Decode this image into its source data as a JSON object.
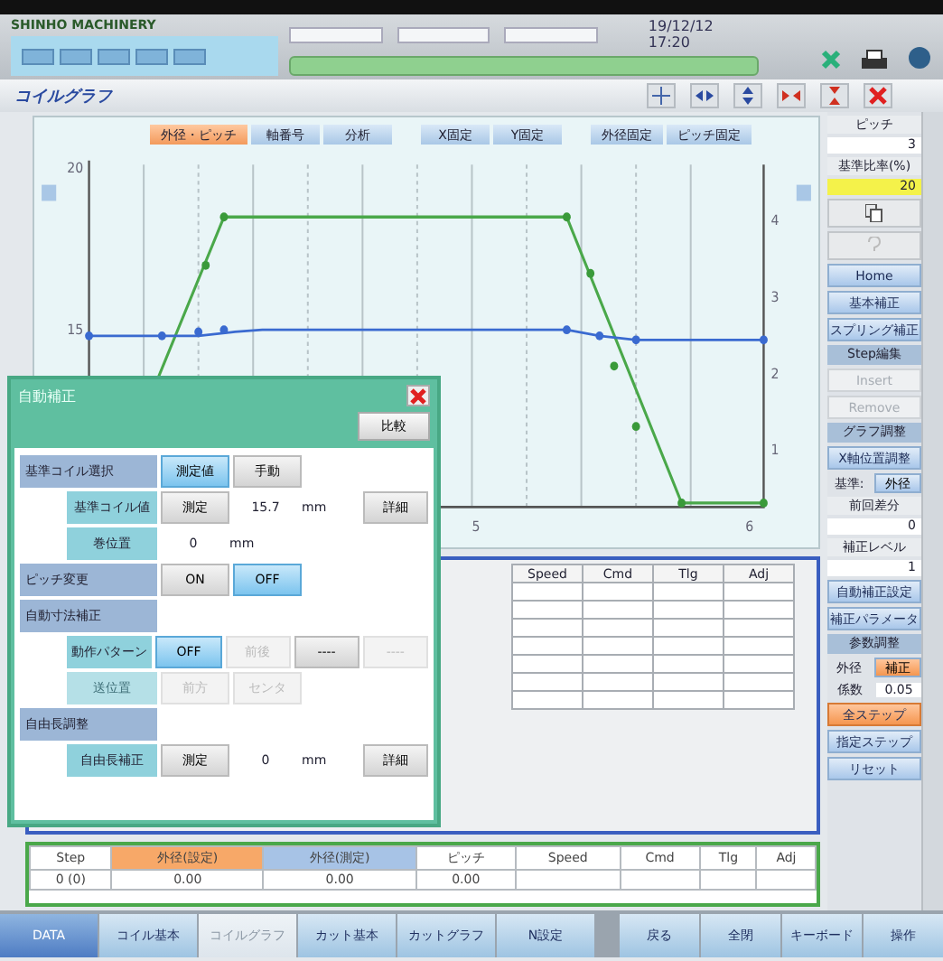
{
  "header": {
    "company": "SHINHO MACHINERY",
    "datetime": "19/12/12 17:20"
  },
  "screen_title": "コイルグラフ",
  "chart_tabs": [
    {
      "label": "外径・ピッチ",
      "selected": true
    },
    {
      "label": "軸番号",
      "selected": false
    },
    {
      "label": "分析",
      "selected": false
    },
    {
      "label": "X固定",
      "selected": false
    },
    {
      "label": "Y固定",
      "selected": false
    },
    {
      "label": "外径固定",
      "selected": false
    },
    {
      "label": "ピッチ固定",
      "selected": false
    }
  ],
  "chart_axes": {
    "left_ticks": [
      "20",
      "15"
    ],
    "right_ticks": [
      "4",
      "3",
      "2",
      "1"
    ],
    "x_ticks": [
      "5",
      "6"
    ]
  },
  "side_panel": [
    {
      "kind": "label",
      "text": "ピッチ"
    },
    {
      "kind": "value",
      "text": "3",
      "highlight": false
    },
    {
      "kind": "label",
      "text": "基準比率(%)"
    },
    {
      "kind": "value",
      "text": "20",
      "highlight": true
    },
    {
      "kind": "icon",
      "disabled": false
    },
    {
      "kind": "icon",
      "disabled": true
    },
    {
      "kind": "button",
      "text": "Home",
      "selected": false,
      "disabled": false
    },
    {
      "kind": "button",
      "text": "基本補正",
      "selected": false,
      "disabled": false
    },
    {
      "kind": "button",
      "text": "スプリング補正",
      "selected": false,
      "disabled": false
    },
    {
      "kind": "header",
      "text": "Step編集"
    },
    {
      "kind": "button",
      "text": "Insert",
      "disabled": true
    },
    {
      "kind": "button",
      "text": "Remove",
      "disabled": true
    },
    {
      "kind": "header",
      "text": "グラフ調整"
    },
    {
      "kind": "button",
      "text": "X軸位置調整",
      "selected": false,
      "disabled": false
    },
    {
      "kind": "toggle_row",
      "label": "基準:",
      "option": {
        "text": "外径",
        "selected": false
      }
    },
    {
      "kind": "label",
      "text": "前回差分"
    },
    {
      "kind": "value",
      "text": "0",
      "highlight": false
    },
    {
      "kind": "label",
      "text": "補正レベル"
    },
    {
      "kind": "value",
      "text": "1",
      "highlight": false
    },
    {
      "kind": "button",
      "text": "自動補正設定",
      "selected": false,
      "disabled": false
    },
    {
      "kind": "button",
      "text": "補正パラメータ",
      "selected": false,
      "disabled": false
    },
    {
      "kind": "header",
      "text": "参数調整"
    },
    {
      "kind": "toggle_row",
      "label": "外径",
      "option": {
        "text": "補正",
        "selected": true
      }
    },
    {
      "kind": "field_row",
      "label": "係数",
      "value": "0.05"
    },
    {
      "kind": "button",
      "text": "全ステップ",
      "selected": true,
      "disabled": false
    },
    {
      "kind": "button",
      "text": "指定ステップ",
      "selected": false,
      "disabled": false
    },
    {
      "kind": "button",
      "text": "リセット",
      "selected": false,
      "disabled": false
    }
  ],
  "dialog": {
    "title": "自動補正",
    "compare_button": "比較",
    "rows": [
      {
        "kind": "section",
        "label": "基準コイル選択",
        "options": [
          {
            "text": "測定値",
            "selected": true,
            "disabled": false
          },
          {
            "text": "手動",
            "selected": false,
            "disabled": false
          }
        ]
      },
      {
        "kind": "row",
        "label": "基準コイル値",
        "options": [
          {
            "text": "測定",
            "selected": false,
            "disabled": false
          }
        ],
        "value": "15.7",
        "unit": "mm",
        "detail_button": "詳細"
      },
      {
        "kind": "row",
        "label": "巻位置",
        "value": "0",
        "unit": "mm"
      },
      {
        "kind": "section",
        "label": "ピッチ変更",
        "options": [
          {
            "text": "ON",
            "selected": false,
            "disabled": false
          },
          {
            "text": "OFF",
            "selected": true,
            "disabled": false
          }
        ]
      },
      {
        "kind": "section",
        "label": "自動寸法補正"
      },
      {
        "kind": "row",
        "label": "動作パターン",
        "options": [
          {
            "text": "OFF",
            "selected": true,
            "disabled": false
          },
          {
            "text": "前後",
            "disabled": true
          },
          {
            "text": "----",
            "selected": false,
            "disabled": false
          },
          {
            "text": "----",
            "disabled": true
          }
        ]
      },
      {
        "kind": "row",
        "label": "送位置",
        "disabled": true,
        "options": [
          {
            "text": "前方",
            "disabled": true
          },
          {
            "text": "センタ",
            "disabled": true
          }
        ]
      },
      {
        "kind": "section",
        "label": "自由長調整"
      },
      {
        "kind": "row",
        "label": "自由長補正",
        "options": [
          {
            "text": "測定",
            "selected": false,
            "disabled": false
          }
        ],
        "value": "0",
        "unit": "mm",
        "detail_button": "詳細"
      }
    ]
  },
  "step_table": {
    "columns": [
      "Speed",
      "Cmd",
      "Tlg",
      "Adj"
    ]
  },
  "data_table": {
    "columns": [
      {
        "text": "Step"
      },
      {
        "text": "外径(設定)",
        "color": "#f7a868"
      },
      {
        "text": "外径(測定)",
        "color": "#a7c3e6"
      },
      {
        "text": "ピッチ"
      },
      {
        "text": "Speed"
      },
      {
        "text": "Cmd"
      },
      {
        "text": "Tlg"
      },
      {
        "text": "Adj"
      }
    ],
    "rows": [
      [
        "0 (0)",
        "0.00",
        "0.00",
        "0.00",
        "",
        "",
        "",
        ""
      ]
    ]
  },
  "nav_tabs": [
    {
      "label": "DATA",
      "selected": false
    },
    {
      "label": "コイル基本",
      "selected": false
    },
    {
      "label": "コイルグラフ",
      "selected": true
    },
    {
      "label": "カット基本",
      "selected": false
    },
    {
      "label": "カットグラフ",
      "selected": false
    },
    {
      "label": "N設定",
      "selected": false
    }
  ],
  "actions": [
    "戻る",
    "全閉",
    "キーボード",
    "操作"
  ]
}
